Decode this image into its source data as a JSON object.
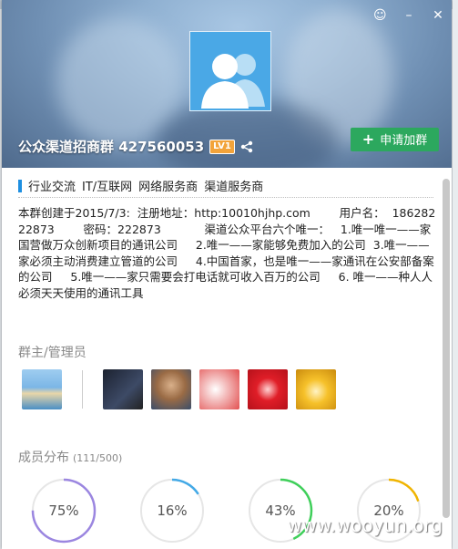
{
  "header": {
    "group_name": "公众渠道招商群 427560053",
    "level_badge": "LV1",
    "join_button": "申请加群",
    "join_icon": "+"
  },
  "window_buttons": {
    "skin": "☺",
    "minimize": "–",
    "close": "✕"
  },
  "tags": [
    "行业交流",
    "IT/互联网",
    "网络服务商",
    "渠道服务商"
  ],
  "description": "本群创建于2015/7/3:  注册地址：http:10010hjhp.com        用户名：  18628222873        密码：222873            渠道公众平台六个唯一：   1.唯一唯一——家国营做万众创新项目的通讯公司     2.唯一——家能够免费加入的公司  3.唯一——家必须主动消费建立管道的公司     4.中国首家，也是唯一——家通讯在公安部备案的公司     5.唯一——家只需要会打电话就可收入百万的公司     6. 唯一——种人人必须天天使用的通讯工具",
  "admins_title": "群主/管理员",
  "stats": {
    "title": "成员分布",
    "count": "(111/500)",
    "rings": [
      {
        "label": "75%",
        "value": 0.75,
        "color": "#9b86e0"
      },
      {
        "label": "16%",
        "value": 0.16,
        "color": "#43a9e6"
      },
      {
        "label": "43%",
        "value": 0.43,
        "color": "#3fcf5a"
      },
      {
        "label": "20%",
        "value": 0.2,
        "color": "#f0b400"
      }
    ]
  },
  "watermark": "www.wooyun.org"
}
